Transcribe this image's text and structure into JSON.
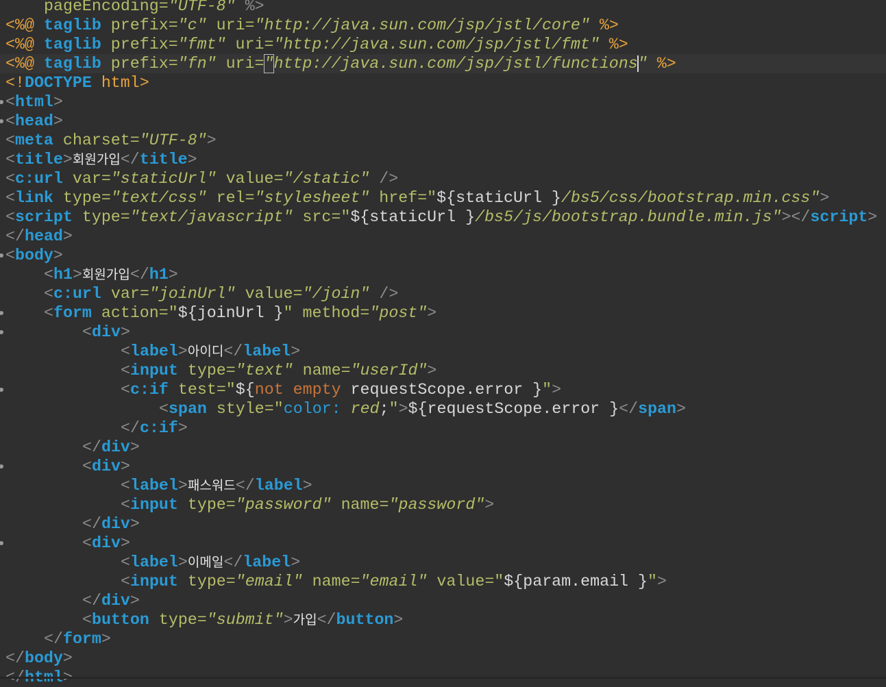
{
  "editor": {
    "lines": [
      {
        "indent": 1,
        "tokens": [
          [
            "attr",
            "pageEncoding"
          ],
          [
            "eq",
            "="
          ],
          [
            "val",
            "\"UTF-8\""
          ],
          [
            "delim",
            " %>"
          ]
        ],
        "clip": true
      },
      {
        "indent": 0,
        "tokens": [
          [
            "dir",
            "<%@ "
          ],
          [
            "kw",
            "taglib "
          ],
          [
            "attr",
            "prefix"
          ],
          [
            "eq",
            "="
          ],
          [
            "val",
            "\"c\""
          ],
          [
            "attr",
            " uri"
          ],
          [
            "eq",
            "="
          ],
          [
            "val",
            "\"http://java.sun.com/jsp/jstl/core\""
          ],
          [
            "dir",
            " %>"
          ]
        ]
      },
      {
        "indent": 0,
        "tokens": [
          [
            "dir",
            "<%@ "
          ],
          [
            "kw",
            "taglib "
          ],
          [
            "attr",
            "prefix"
          ],
          [
            "eq",
            "="
          ],
          [
            "val",
            "\"fmt\""
          ],
          [
            "attr",
            " uri"
          ],
          [
            "eq",
            "="
          ],
          [
            "val",
            "\"http://java.sun.com/jsp/jstl/fmt\""
          ],
          [
            "dir",
            " %>"
          ]
        ]
      },
      {
        "indent": 0,
        "active": true,
        "tokens": [
          [
            "dir",
            "<%@ "
          ],
          [
            "kw",
            "taglib "
          ],
          [
            "attr",
            "prefix"
          ],
          [
            "eq",
            "="
          ],
          [
            "val",
            "\"fn\""
          ],
          [
            "attr",
            " uri"
          ],
          [
            "eq",
            "="
          ],
          [
            "match",
            "\""
          ],
          [
            "val",
            "http://java.sun.com/jsp/jstl/functions"
          ],
          [
            "cursor",
            ""
          ],
          [
            "val",
            "\""
          ],
          [
            "dir",
            " %>"
          ]
        ]
      },
      {
        "indent": 0,
        "tokens": [
          [
            "doc",
            "<!"
          ],
          [
            "kw",
            "DOCTYPE"
          ],
          [
            "doc",
            " html>"
          ]
        ]
      },
      {
        "indent": 0,
        "dot": true,
        "tokens": [
          [
            "delim",
            "<"
          ],
          [
            "tag",
            "html"
          ],
          [
            "delim",
            ">"
          ]
        ]
      },
      {
        "indent": 0,
        "dot": true,
        "tokens": [
          [
            "delim",
            "<"
          ],
          [
            "tag",
            "head"
          ],
          [
            "delim",
            ">"
          ]
        ]
      },
      {
        "indent": 0,
        "tokens": [
          [
            "delim",
            "<"
          ],
          [
            "tag",
            "meta"
          ],
          [
            "attr",
            " charset"
          ],
          [
            "eq",
            "="
          ],
          [
            "val",
            "\"UTF-8\""
          ],
          [
            "delim",
            ">"
          ]
        ]
      },
      {
        "indent": 0,
        "tokens": [
          [
            "delim",
            "<"
          ],
          [
            "tag",
            "title"
          ],
          [
            "delim",
            ">"
          ],
          [
            "text",
            "회원가입"
          ],
          [
            "delim",
            "</"
          ],
          [
            "tag",
            "title"
          ],
          [
            "delim",
            ">"
          ]
        ]
      },
      {
        "indent": 0,
        "tokens": [
          [
            "delim",
            "<"
          ],
          [
            "tag",
            "c:url"
          ],
          [
            "attr",
            " var"
          ],
          [
            "eq",
            "="
          ],
          [
            "val",
            "\"staticUrl\""
          ],
          [
            "attr",
            " value"
          ],
          [
            "eq",
            "="
          ],
          [
            "val",
            "\"/static\""
          ],
          [
            "delim",
            " />"
          ]
        ]
      },
      {
        "indent": 0,
        "tokens": [
          [
            "delim",
            "<"
          ],
          [
            "tag",
            "link"
          ],
          [
            "attr",
            " type"
          ],
          [
            "eq",
            "="
          ],
          [
            "val",
            "\"text/css\""
          ],
          [
            "attr",
            " rel"
          ],
          [
            "eq",
            "="
          ],
          [
            "val",
            "\"stylesheet\""
          ],
          [
            "attr",
            " href"
          ],
          [
            "eq",
            "="
          ],
          [
            "quote",
            "\""
          ],
          [
            "el",
            "${staticUrl }"
          ],
          [
            "val",
            "/bs5/css/bootstrap.min.css\""
          ],
          [
            "delim",
            ">"
          ]
        ]
      },
      {
        "indent": 0,
        "tokens": [
          [
            "delim",
            "<"
          ],
          [
            "tag",
            "script"
          ],
          [
            "attr",
            " type"
          ],
          [
            "eq",
            "="
          ],
          [
            "val",
            "\"text/javascript\""
          ],
          [
            "attr",
            " src"
          ],
          [
            "eq",
            "="
          ],
          [
            "quote",
            "\""
          ],
          [
            "el",
            "${staticUrl }"
          ],
          [
            "val",
            "/bs5/js/bootstrap.bundle.min.js\""
          ],
          [
            "delim",
            "></"
          ],
          [
            "tag",
            "script"
          ],
          [
            "delim",
            ">"
          ]
        ]
      },
      {
        "indent": 0,
        "tokens": [
          [
            "delim",
            "</"
          ],
          [
            "tag",
            "head"
          ],
          [
            "delim",
            ">"
          ]
        ]
      },
      {
        "indent": 0,
        "dot": true,
        "tokens": [
          [
            "delim",
            "<"
          ],
          [
            "tag",
            "body"
          ],
          [
            "delim",
            ">"
          ]
        ]
      },
      {
        "indent": 1,
        "tokens": [
          [
            "delim",
            "<"
          ],
          [
            "tag",
            "h1"
          ],
          [
            "delim",
            ">"
          ],
          [
            "text",
            "회원가입"
          ],
          [
            "delim",
            "</"
          ],
          [
            "tag",
            "h1"
          ],
          [
            "delim",
            ">"
          ]
        ]
      },
      {
        "indent": 1,
        "tokens": [
          [
            "delim",
            "<"
          ],
          [
            "tag",
            "c:url"
          ],
          [
            "attr",
            " var"
          ],
          [
            "eq",
            "="
          ],
          [
            "val",
            "\"joinUrl\""
          ],
          [
            "attr",
            " value"
          ],
          [
            "eq",
            "="
          ],
          [
            "val",
            "\"/join\""
          ],
          [
            "delim",
            " />"
          ]
        ]
      },
      {
        "indent": 1,
        "dot": true,
        "tokens": [
          [
            "delim",
            "<"
          ],
          [
            "tag",
            "form"
          ],
          [
            "attr",
            " action"
          ],
          [
            "eq",
            "="
          ],
          [
            "quote",
            "\""
          ],
          [
            "el",
            "${joinUrl }"
          ],
          [
            "quote",
            "\""
          ],
          [
            "attr",
            " method"
          ],
          [
            "eq",
            "="
          ],
          [
            "val",
            "\"post\""
          ],
          [
            "delim",
            ">"
          ]
        ]
      },
      {
        "indent": 2,
        "dot": true,
        "tokens": [
          [
            "delim",
            "<"
          ],
          [
            "tag",
            "div"
          ],
          [
            "delim",
            ">"
          ]
        ]
      },
      {
        "indent": 3,
        "tokens": [
          [
            "delim",
            "<"
          ],
          [
            "tag",
            "label"
          ],
          [
            "delim",
            ">"
          ],
          [
            "text",
            "아이디"
          ],
          [
            "delim",
            "</"
          ],
          [
            "tag",
            "label"
          ],
          [
            "delim",
            ">"
          ]
        ]
      },
      {
        "indent": 3,
        "tokens": [
          [
            "delim",
            "<"
          ],
          [
            "tag",
            "input"
          ],
          [
            "attr",
            " type"
          ],
          [
            "eq",
            "="
          ],
          [
            "val",
            "\"text\""
          ],
          [
            "attr",
            " name"
          ],
          [
            "eq",
            "="
          ],
          [
            "val",
            "\"userId\""
          ],
          [
            "delim",
            ">"
          ]
        ]
      },
      {
        "indent": 3,
        "dot": true,
        "tokens": [
          [
            "delim",
            "<"
          ],
          [
            "tag",
            "c:if"
          ],
          [
            "attr",
            " test"
          ],
          [
            "eq",
            "="
          ],
          [
            "quote",
            "\""
          ],
          [
            "el",
            "${"
          ],
          [
            "elkw",
            "not empty"
          ],
          [
            "el",
            " requestScope.error }"
          ],
          [
            "quote",
            "\""
          ],
          [
            "delim",
            ">"
          ]
        ]
      },
      {
        "indent": 4,
        "tokens": [
          [
            "delim",
            "<"
          ],
          [
            "tag",
            "span"
          ],
          [
            "attr",
            " style"
          ],
          [
            "eq",
            "="
          ],
          [
            "quote",
            "\""
          ],
          [
            "css",
            "color: "
          ],
          [
            "val",
            "red"
          ],
          [
            "el",
            ";"
          ],
          [
            "quote",
            "\""
          ],
          [
            "delim",
            ">"
          ],
          [
            "el",
            "${requestScope.error }"
          ],
          [
            "delim",
            "</"
          ],
          [
            "tag",
            "span"
          ],
          [
            "delim",
            ">"
          ]
        ]
      },
      {
        "indent": 3,
        "tokens": [
          [
            "delim",
            "</"
          ],
          [
            "tag",
            "c:if"
          ],
          [
            "delim",
            ">"
          ]
        ]
      },
      {
        "indent": 2,
        "tokens": [
          [
            "delim",
            "</"
          ],
          [
            "tag",
            "div"
          ],
          [
            "delim",
            ">"
          ]
        ]
      },
      {
        "indent": 2,
        "dot": true,
        "tokens": [
          [
            "delim",
            "<"
          ],
          [
            "tag",
            "div"
          ],
          [
            "delim",
            ">"
          ]
        ]
      },
      {
        "indent": 3,
        "tokens": [
          [
            "delim",
            "<"
          ],
          [
            "tag",
            "label"
          ],
          [
            "delim",
            ">"
          ],
          [
            "text",
            "패스워드"
          ],
          [
            "delim",
            "</"
          ],
          [
            "tag",
            "label"
          ],
          [
            "delim",
            ">"
          ]
        ]
      },
      {
        "indent": 3,
        "tokens": [
          [
            "delim",
            "<"
          ],
          [
            "tag",
            "input"
          ],
          [
            "attr",
            " type"
          ],
          [
            "eq",
            "="
          ],
          [
            "val",
            "\"password\""
          ],
          [
            "attr",
            " name"
          ],
          [
            "eq",
            "="
          ],
          [
            "val",
            "\"password\""
          ],
          [
            "delim",
            ">"
          ]
        ]
      },
      {
        "indent": 2,
        "tokens": [
          [
            "delim",
            "</"
          ],
          [
            "tag",
            "div"
          ],
          [
            "delim",
            ">"
          ]
        ]
      },
      {
        "indent": 2,
        "dot": true,
        "tokens": [
          [
            "delim",
            "<"
          ],
          [
            "tag",
            "div"
          ],
          [
            "delim",
            ">"
          ]
        ]
      },
      {
        "indent": 3,
        "tokens": [
          [
            "delim",
            "<"
          ],
          [
            "tag",
            "label"
          ],
          [
            "delim",
            ">"
          ],
          [
            "text",
            "이메일"
          ],
          [
            "delim",
            "</"
          ],
          [
            "tag",
            "label"
          ],
          [
            "delim",
            ">"
          ]
        ]
      },
      {
        "indent": 3,
        "tokens": [
          [
            "delim",
            "<"
          ],
          [
            "tag",
            "input"
          ],
          [
            "attr",
            " type"
          ],
          [
            "eq",
            "="
          ],
          [
            "val",
            "\"email\""
          ],
          [
            "attr",
            " name"
          ],
          [
            "eq",
            "="
          ],
          [
            "val",
            "\"email\""
          ],
          [
            "attr",
            " value"
          ],
          [
            "eq",
            "="
          ],
          [
            "quote",
            "\""
          ],
          [
            "el",
            "${param.email }"
          ],
          [
            "quote",
            "\""
          ],
          [
            "delim",
            ">"
          ]
        ]
      },
      {
        "indent": 2,
        "tokens": [
          [
            "delim",
            "</"
          ],
          [
            "tag",
            "div"
          ],
          [
            "delim",
            ">"
          ]
        ]
      },
      {
        "indent": 2,
        "tokens": [
          [
            "delim",
            "<"
          ],
          [
            "tag",
            "button"
          ],
          [
            "attr",
            " type"
          ],
          [
            "eq",
            "="
          ],
          [
            "val",
            "\"submit\""
          ],
          [
            "delim",
            ">"
          ],
          [
            "text",
            "가입"
          ],
          [
            "delim",
            "</"
          ],
          [
            "tag",
            "button"
          ],
          [
            "delim",
            ">"
          ]
        ]
      },
      {
        "indent": 1,
        "tokens": [
          [
            "delim",
            "</"
          ],
          [
            "tag",
            "form"
          ],
          [
            "delim",
            ">"
          ]
        ]
      },
      {
        "indent": 0,
        "tokens": [
          [
            "delim",
            "</"
          ],
          [
            "tag",
            "body"
          ],
          [
            "delim",
            ">"
          ]
        ]
      },
      {
        "indent": 0,
        "tokens": [
          [
            "delim",
            "</"
          ],
          [
            "tag",
            "html"
          ],
          [
            "delim",
            ">"
          ]
        ]
      }
    ]
  },
  "colors": {
    "background": "#2f2f2f",
    "tag": "#2a9bd6",
    "attribute": "#b5bd68",
    "directive": "#e8a33c",
    "el_keyword": "#c8743a"
  }
}
